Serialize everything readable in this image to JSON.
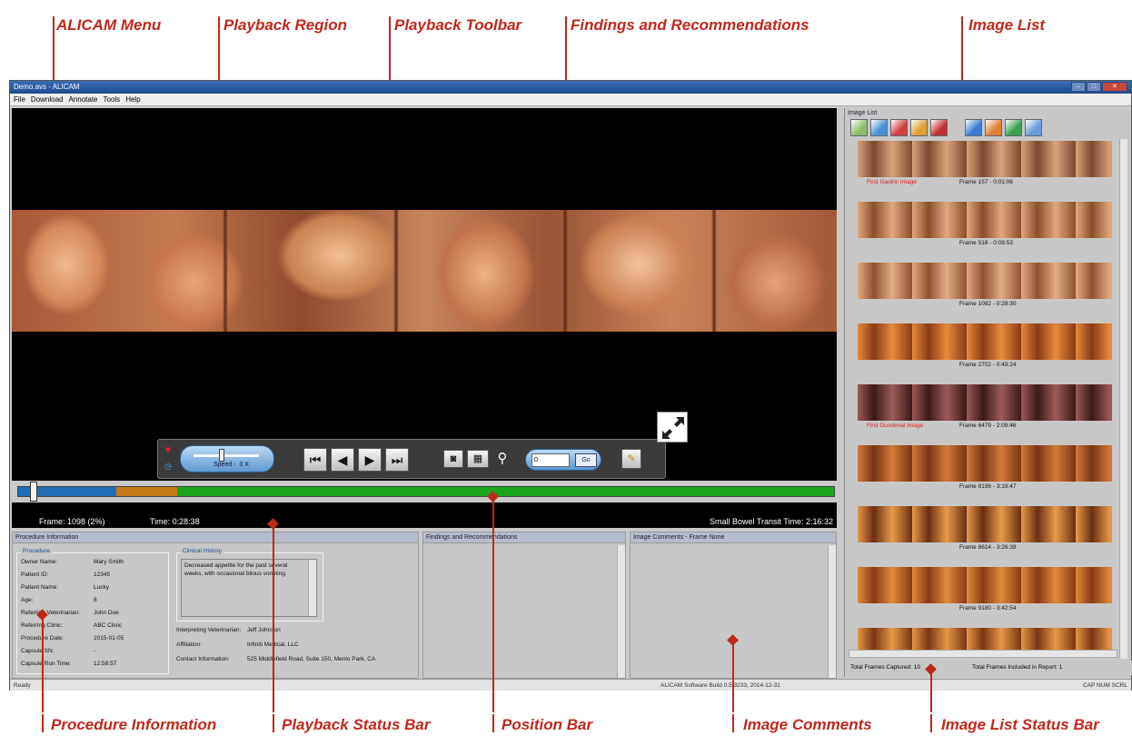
{
  "callouts": {
    "menu": "ALICAM Menu",
    "playback_region": "Playback Region",
    "playback_toolbar": "Playback Toolbar",
    "findings": "Findings and Recommendations",
    "image_list": "Image List",
    "procedure_info": "Procedure Information",
    "playback_status_bar": "Playback Status Bar",
    "position_bar": "Position Bar",
    "image_comments": "Image Comments",
    "image_list_status_bar": "Image List Status Bar"
  },
  "window": {
    "title": "Demo.avs - ALICAM"
  },
  "menu": [
    "File",
    "Download",
    "Annotate",
    "Tools",
    "Help"
  ],
  "toolbar": {
    "speed_label": "Speed",
    "speed_value": "3 X",
    "goto_value": "0",
    "goto_button": "Go"
  },
  "position_bar": {
    "segments": [
      {
        "fraction": 0.12,
        "color": "#1f6fb8"
      },
      {
        "fraction": 0.075,
        "color": "#c67a17"
      },
      {
        "fraction": 0.805,
        "color": "#1aa51a"
      }
    ],
    "thumb_fraction": 0.02
  },
  "playback_status": {
    "frame": "Frame: 1098  (2%)",
    "time": "Time: 0:28:38",
    "transit": "Small Bowel Transit Time: 2:16:32"
  },
  "procedure": {
    "panel_title": "Procedure Information",
    "group_title": "Procedure",
    "rows": [
      {
        "label": "Owner Name:",
        "value": "Mary Smith"
      },
      {
        "label": "Patient ID:",
        "value": "12345"
      },
      {
        "label": "Patient Name:",
        "value": "Lucky"
      },
      {
        "label": "Age:",
        "value": "8"
      },
      {
        "label": "Referring Veterinarian:",
        "value": "John Doe"
      },
      {
        "label": "Referring Clinic:",
        "value": "ABC Clinic"
      },
      {
        "label": "Procedure Date:",
        "value": "2015-01-05"
      },
      {
        "label": "Capsule SN:",
        "value": "-"
      },
      {
        "label": "Capsule Run Time:",
        "value": "12:58:57"
      }
    ],
    "history_title": "Clinical History",
    "history_text_1": "Decreased appetite for the past several",
    "history_text_2": "weeks, with occasional bilous vomiting.",
    "interpreting_vet": {
      "label": "Interpreting Veterinarian:",
      "value": "Jeff Johnson"
    },
    "affiliation": {
      "label": "Affiliation:",
      "value": "Infiniti Medical, LLC"
    },
    "contact": {
      "label": "Contact Information:",
      "value": "525 Middlefield Road, Suite 150, Menlo Park, CA"
    }
  },
  "findings": {
    "title": "Findings and Recommendations"
  },
  "comments": {
    "title": "Image Comments - Frame None"
  },
  "image_list": {
    "title": "Image List",
    "tool_colors": [
      "#8fbf6a",
      "#4a8fd4",
      "#d64040",
      "#e0a030",
      "#c03030",
      "#3b7bd0",
      "#e08030",
      "#3aa050",
      "#6a9ad8"
    ],
    "items": [
      {
        "tag": "First Gastric Image",
        "frame": "Frame 157 - 0:01:06",
        "c1": "#d9a37b",
        "c2": "#7a4a30"
      },
      {
        "tag": "",
        "frame": "Frame 518 - 0:09:53",
        "c1": "#e0a87e",
        "c2": "#8a4e2c"
      },
      {
        "tag": "",
        "frame": "Frame 1092 - 0:28:30",
        "c1": "#e2ad82",
        "c2": "#8e5230"
      },
      {
        "tag": "",
        "frame": "Frame 2702 - 0:49:24",
        "c1": "#e88a3c",
        "c2": "#8a3a14"
      },
      {
        "tag": "First Duodenal Image",
        "frame": "Frame 6479 - 2:09:46",
        "c1": "#9a5a58",
        "c2": "#3a1a18"
      },
      {
        "tag": "",
        "frame": "Frame 8196 - 3:19:47",
        "c1": "#d47a3a",
        "c2": "#7a3412"
      },
      {
        "tag": "",
        "frame": "Frame 8614 - 3:26:39",
        "c1": "#e89a4a",
        "c2": "#6a2e10"
      },
      {
        "tag": "",
        "frame": "Frame 9180 - 3:42:54",
        "c1": "#e08a3a",
        "c2": "#8a3a14"
      },
      {
        "tag": "",
        "frame": "",
        "c1": "#e69846",
        "c2": "#7a3412"
      }
    ],
    "status_captured": "Total Frames Captured:  10",
    "status_included": "Total Frames Included in Report:  1"
  },
  "app_status": {
    "left": "Ready",
    "build": "ALICAM Software Build 0.5.3233, 2014-12-31",
    "keys": "CAP  NUM  SCRL"
  }
}
